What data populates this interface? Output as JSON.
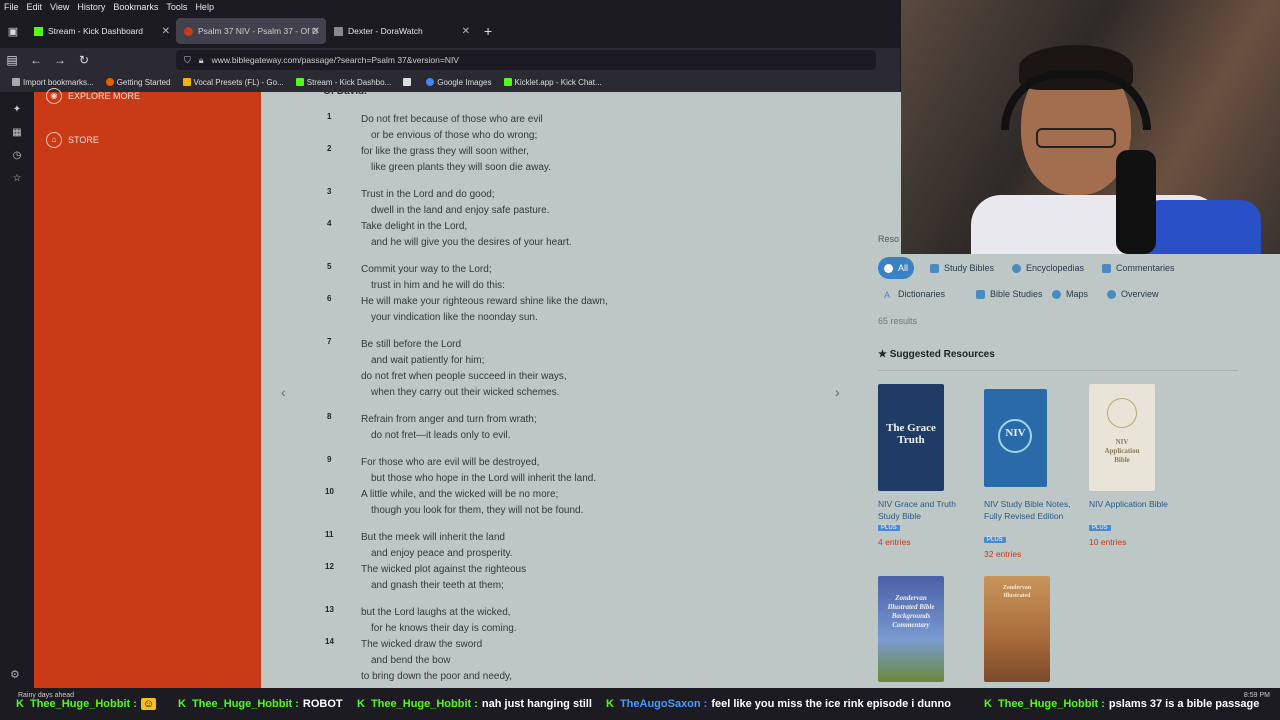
{
  "browser": {
    "menu": [
      "File",
      "Edit",
      "View",
      "History",
      "Bookmarks",
      "Tools",
      "Help"
    ],
    "tabs": [
      {
        "label": "Stream - Kick Dashboard",
        "fav_color": "#53fc18",
        "active": false
      },
      {
        "label": "Psalm 37 NIV - Psalm 37 - Of D",
        "fav_color": "#c93a17",
        "active": true
      },
      {
        "label": "Dexter - DoraWatch",
        "fav_color": "#888888",
        "active": false
      }
    ],
    "url": "www.biblegateway.com/passage/?search=Psalm 37&version=NIV",
    "bookmarks": [
      {
        "label": "Import bookmarks...",
        "color": "#aaaaaa"
      },
      {
        "label": "Getting Started",
        "color": "#e66000"
      },
      {
        "label": "Vocal Presets (FL) - Go...",
        "color": "#f4b400"
      },
      {
        "label": "Stream - Kick Dashbo...",
        "color": "#53fc18"
      },
      {
        "label": "",
        "color": "#dddddd"
      },
      {
        "label": "Google Images",
        "color": "#4285f4"
      },
      {
        "label": "Kicklet.app - Kick Chat...",
        "color": "#53fc18"
      }
    ]
  },
  "leftnav": {
    "explore": "EXPLORE MORE",
    "store": "STORE"
  },
  "passage": {
    "heading": "Of David.",
    "verses": [
      {
        "num": "1",
        "lines": [
          "Do not fret because of those who are evil",
          "or be envious of those who do wrong;"
        ]
      },
      {
        "num": "2",
        "lines": [
          "for like the grass they will soon wither,",
          "like green plants they will soon die away."
        ]
      },
      {
        "num": "3",
        "lines": [
          "Trust in the Lord and do good;",
          "dwell in the land and enjoy safe pasture."
        ]
      },
      {
        "num": "4",
        "lines": [
          "Take delight in the Lord,",
          "and he will give you the desires of your heart."
        ]
      },
      {
        "num": "5",
        "lines": [
          "Commit your way to the Lord;",
          "trust in him and he will do this:"
        ]
      },
      {
        "num": "6",
        "lines": [
          "He will make your righteous reward shine like the dawn,",
          "your vindication like the noonday sun."
        ]
      },
      {
        "num": "7",
        "lines": [
          "Be still before the Lord",
          "and wait patiently for him;",
          "do not fret when people succeed in their ways,",
          "when they carry out their wicked schemes."
        ]
      },
      {
        "num": "8",
        "lines": [
          "Refrain from anger and turn from wrath;",
          "do not fret—it leads only to evil."
        ]
      },
      {
        "num": "9",
        "lines": [
          "For those who are evil will be destroyed,",
          "but those who hope in the Lord will inherit the land."
        ]
      },
      {
        "num": "10",
        "lines": [
          "A little while, and the wicked will be no more;",
          "though you look for them, they will not be found."
        ]
      },
      {
        "num": "11",
        "lines": [
          "But the meek will inherit the land",
          "and enjoy peace and prosperity."
        ]
      },
      {
        "num": "12",
        "lines": [
          "The wicked plot against the righteous",
          "and gnash their teeth at them;"
        ]
      },
      {
        "num": "13",
        "lines": [
          "but the Lord laughs at the wicked,",
          "for he knows their day is coming."
        ]
      },
      {
        "num": "14",
        "lines": [
          "The wicked draw the sword",
          "and bend the bow",
          "to bring down the poor and needy,"
        ]
      }
    ]
  },
  "resources": {
    "label": "Reso",
    "filters": [
      "All",
      "Study Bibles",
      "Encyclopedias",
      "Commentaries",
      "Dictionaries",
      "Bible Studies",
      "Maps",
      "Overview"
    ],
    "results": "65 results",
    "suggested": "Suggested Resources",
    "books": [
      {
        "title": "NIV Grace and Truth Study Bible",
        "plus": "PLUS",
        "entries": "4 entries",
        "cover": "The Grace Truth"
      },
      {
        "title": "NIV Study Bible Notes, Fully Revised Edition",
        "plus": "PLUS",
        "entries": "32 entries",
        "cover": "NIV"
      },
      {
        "title": "NIV Application Bible",
        "plus": "PLUS",
        "entries": "10 entries",
        "cover": "NIV Application Bible"
      },
      {
        "title": "",
        "plus": "",
        "entries": "",
        "cover": "Zondervan Illustrated Bible Backgrounds Commentary"
      },
      {
        "title": "",
        "plus": "",
        "entries": "",
        "cover": "Zondervan Illustrated"
      }
    ]
  },
  "stream": {
    "weather": "Rainy days ahead",
    "time": "8:59 PM",
    "chat": [
      {
        "user": "Thee_Huge_Hobbit :",
        "msg": ""
      },
      {
        "user": "Thee_Huge_Hobbit :",
        "msg": "ROBOT"
      },
      {
        "user": "Thee_Huge_Hobbit :",
        "msg": "nah just hanging still"
      },
      {
        "user": "TheAugoSaxon :",
        "msg": "feel like you miss the ice rink episode i dunno"
      },
      {
        "user": "Thee_Huge_Hobbit :",
        "msg": "pslams 37 is a bible passage"
      }
    ]
  }
}
